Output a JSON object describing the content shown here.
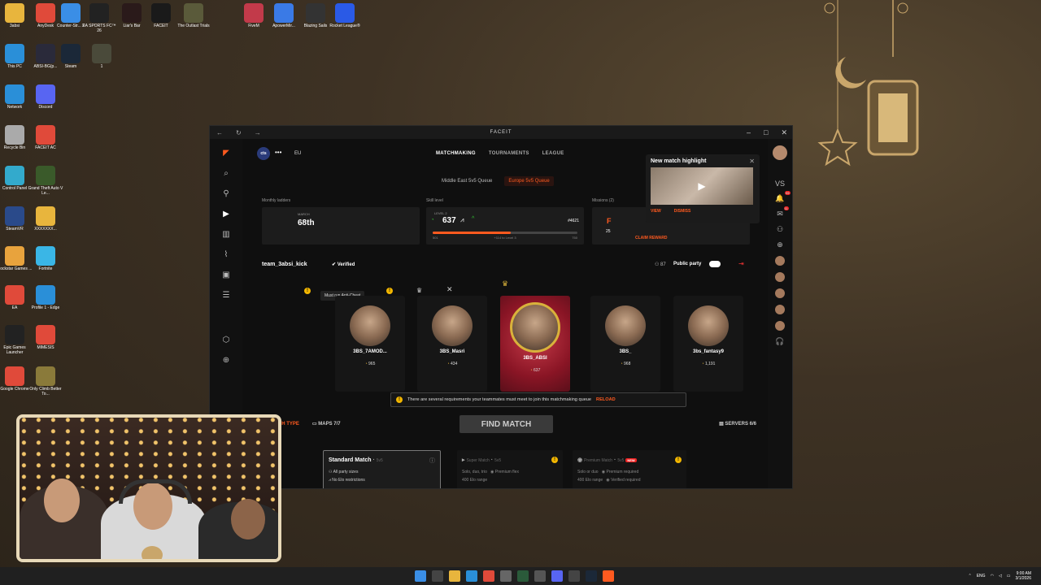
{
  "desktop": {
    "icons": [
      "3absi",
      "AnyDesk",
      "Counter-Str... 2",
      "EA SPORTS FC™ 26",
      "Liar's Bar",
      "FACEIT",
      "The Outlast Trials",
      "FiveM",
      "ApowerMir...",
      "Blazing Sails",
      "Rocket League®",
      "This PC",
      "ABSI-BG(p...",
      "Steam",
      "1",
      "Network",
      "Discord",
      "Recycle Bin",
      "FACEIT AC",
      "Control Panel",
      "Grand Theft Auto V Le...",
      "SteamVR",
      "XXXXXXX...",
      "Rockstar Games ...",
      "Fortnite",
      "EA",
      "Profile 1 - Edge",
      "Epic Games Launcher",
      "MIMESIS",
      "Google Chrome",
      "Only Climb Better To..."
    ]
  },
  "window": {
    "title": "FACEIT",
    "top_tabs": [
      "MATCHMAKING",
      "TOURNAMENTS",
      "LEAGUE"
    ],
    "org_logo": "cts",
    "region": "EU",
    "queues": [
      "Middle East 5v5 Queue",
      "Europe 5v5 Queue"
    ],
    "monthly_ladders_label": "Monthly ladders",
    "month_label": "MARCH",
    "ladder_rank": "68th",
    "skill_label": "Skill level",
    "level_label": "LEVEL 2",
    "elo": "637",
    "rank_badge": "#4621",
    "elo_min": "501",
    "elo_to_next": "+114 to Level 3",
    "elo_max": "750",
    "level_progress": 0.54,
    "missions_label": "Missions (2)",
    "mission_count": "25",
    "mission_claim": "CLAIM REWARD",
    "team_name": "team_3absi_kick",
    "verified": "Verified",
    "party_count": "87",
    "party_mode": "Public party",
    "tooltip": "Must run Anti-Cheat",
    "players": [
      {
        "name": "3BS_7AMOD...",
        "elo": "965"
      },
      {
        "name": "3BS_Masri",
        "elo": "434"
      },
      {
        "name": "3BS_ABSI",
        "elo": "637"
      },
      {
        "name": "3BS_",
        "elo": "968"
      },
      {
        "name": "3bs_fantasy9",
        "elo": "1,191"
      }
    ],
    "banner_text": "There are several requirements your teammates must meet to join this matchmaking queue",
    "banner_action": "RELOAD",
    "match_type": "MATCH TYPE",
    "maps": "MAPS 7/7",
    "find_match": "FIND MATCH",
    "servers": "SERVERS 6/6",
    "match_cards": [
      {
        "title": "Standard Match",
        "mode": "5v5",
        "lines": [
          "All party sizes",
          "No Elo restrictions"
        ]
      },
      {
        "title": "Super Match",
        "mode": "5v5",
        "lines": [
          "Solo, duo, trio",
          "Premium flex",
          "400 Elo range"
        ]
      },
      {
        "title": "Premium Match",
        "mode": "5v5",
        "badge": "NEW",
        "lines": [
          "Solo or duo",
          "Premium required",
          "400 Elo range",
          "Verified required"
        ]
      }
    ],
    "highlight": {
      "title": "New match highlight",
      "view": "VIEW",
      "dismiss": "DISMISS"
    },
    "right_vs": "VS",
    "notif_badge_1": "99",
    "notif_badge_2": "11"
  },
  "taskbar": {
    "lang": "ENG",
    "time": "9:00 AM",
    "date": "3/1/2026"
  }
}
